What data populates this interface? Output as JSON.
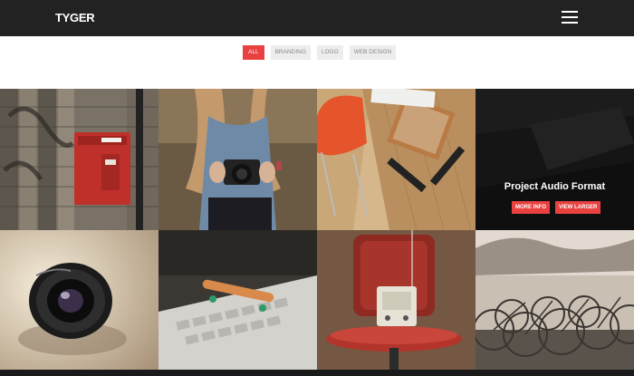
{
  "header": {
    "brand": "TYGER",
    "menu_icon": "hamburger-icon"
  },
  "filters": [
    {
      "label": "ALL",
      "active": true
    },
    {
      "label": "BRANDING",
      "active": false
    },
    {
      "label": "LOGO",
      "active": false
    },
    {
      "label": "WEB DESIGN",
      "active": false
    }
  ],
  "portfolio": {
    "items": [
      {
        "subject": "red mailbox on tiled wall"
      },
      {
        "subject": "woman holding camera"
      },
      {
        "subject": "desk with orange chair and notebook"
      },
      {
        "subject": "dark project",
        "hover_title": "Project Audio Format",
        "more_info": "MORE INFO",
        "view_larger": "VIEW LARGER"
      },
      {
        "subject": "camera lens"
      },
      {
        "subject": "skateboard on keyboard"
      },
      {
        "subject": "radio on red chair"
      },
      {
        "subject": "row of bicycles"
      }
    ]
  },
  "colors": {
    "accent": "#e8413f",
    "topbar": "#222222",
    "filter_bg": "#ededed"
  }
}
